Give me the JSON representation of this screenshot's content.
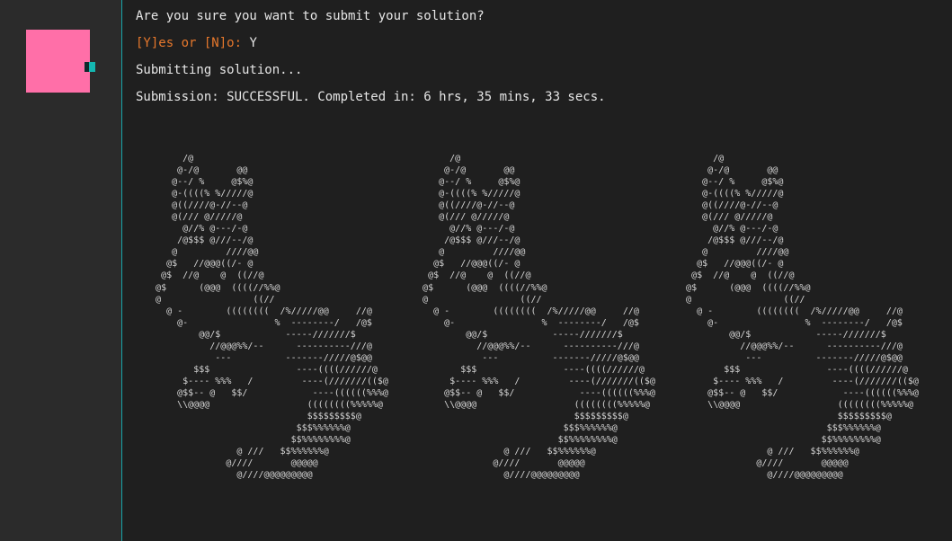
{
  "terminal": {
    "question": "Are you sure you want to submit your solution?",
    "prompt": "[Y]es or [N]o:",
    "answer": "Y",
    "status": "Submitting solution...",
    "result": "Submission: SUCCESSFUL. Completed in: 6 hrs, 35 mins, 33 secs."
  },
  "sidebar": {
    "avatar_color": "#ff6fa8",
    "accent_color": "#14b7b0"
  },
  "ascii_art": {
    "figure": "        /@\n       @-/@       @@\n      @--/ %     @$%@\n      @-((((% %/////@\n      @((////@-//--@\n      @(/// @/////@\n        @//% @---/-@\n       /@$$$ @///--/@\n      @         ////@@\n     @$   //@@@((/- @\n    @$  //@    @  ((//@\n   @$      (@@@  ((((//%%@\n   @                 ((//\n     @ -        ((((((((  /%/////@@     //@\n       @-                %  --------/   /@$\n           @@/$            -----///////$\n             //@@@%%/--      ----------///@\n              ---          -------/////@$@@\n          $$$                ----((((//////@\n        $---- %%%   /         ----(///////(($@\n       @$$-- @   $$/            ----((((((%%%@\n       \\\\@@@@                  ((((((((%%%%%@\n                               $$$$$$$$$@\n                             $$$%%%%%%@\n                            $$%%%%%%%%@\n                  @ ///   $$%%%%%%@\n                @////       @@@@@\n                  @////@@@@@@@@@"
  }
}
